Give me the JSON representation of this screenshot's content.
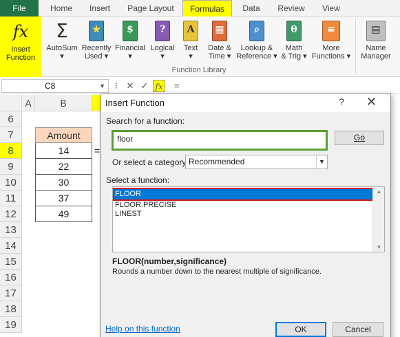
{
  "ribbon": {
    "tabs": [
      "File",
      "Home",
      "Insert",
      "Page Layout",
      "Formulas",
      "Data",
      "Review",
      "View"
    ],
    "active_tab": "Formulas",
    "insert_function": {
      "line1": "Insert",
      "line2": "Function"
    },
    "buttons": [
      {
        "line1": "AutoSum",
        "line2": "▾",
        "icon": "sigma-icon"
      },
      {
        "line1": "Recently",
        "line2": "Used ▾",
        "icon": "star-book-icon"
      },
      {
        "line1": "Financial",
        "line2": "▾",
        "icon": "financial-book-icon"
      },
      {
        "line1": "Logical",
        "line2": "▾",
        "icon": "logical-book-icon"
      },
      {
        "line1": "Text",
        "line2": "▾",
        "icon": "text-book-icon"
      },
      {
        "line1": "Date &",
        "line2": "Time ▾",
        "icon": "datetime-book-icon"
      },
      {
        "line1": "Lookup &",
        "line2": "Reference ▾",
        "icon": "lookup-book-icon"
      },
      {
        "line1": "Math",
        "line2": "& Trig ▾",
        "icon": "math-book-icon"
      },
      {
        "line1": "More",
        "line2": "Functions ▾",
        "icon": "more-books-icon"
      },
      {
        "line1": "Name",
        "line2": "Manager",
        "icon": "name-manager-icon"
      }
    ],
    "group_label": "Function Library"
  },
  "formula_bar": {
    "name_box": "C8",
    "content": "="
  },
  "grid": {
    "columns": [
      "A",
      "B"
    ],
    "rows": [
      "6",
      "7",
      "8",
      "9",
      "10",
      "11",
      "12",
      "13",
      "14",
      "15",
      "16",
      "17",
      "18",
      "19"
    ],
    "selected_row": "8",
    "header_cell": "Amount",
    "values": [
      "14",
      "22",
      "30",
      "37",
      "49"
    ],
    "c8_value": "="
  },
  "dialog": {
    "title": "Insert Function",
    "help": "?",
    "close": "✕",
    "search_label": "Search for a function:",
    "search_value": "floor",
    "go_label": "Go",
    "category_label": "Or select a category:",
    "category_value": "Recommended",
    "select_label": "Select a function:",
    "functions": [
      "FLOOR",
      "FLOOR.PRECISE",
      "LINEST"
    ],
    "selected_function": "FLOOR",
    "signature": "FLOOR(number,significance)",
    "description": "Rounds a number down to the nearest multiple of significance.",
    "help_link": "Help on this function",
    "ok_label": "OK",
    "cancel_label": "Cancel"
  },
  "colors": {
    "excel_green": "#217346",
    "highlight_yellow": "#ffff00",
    "selection_blue": "#0078d7",
    "search_border_green": "#5a9e35",
    "list_border_red": "#cc1b1b",
    "amount_header_fill": "#fbd6bd"
  }
}
